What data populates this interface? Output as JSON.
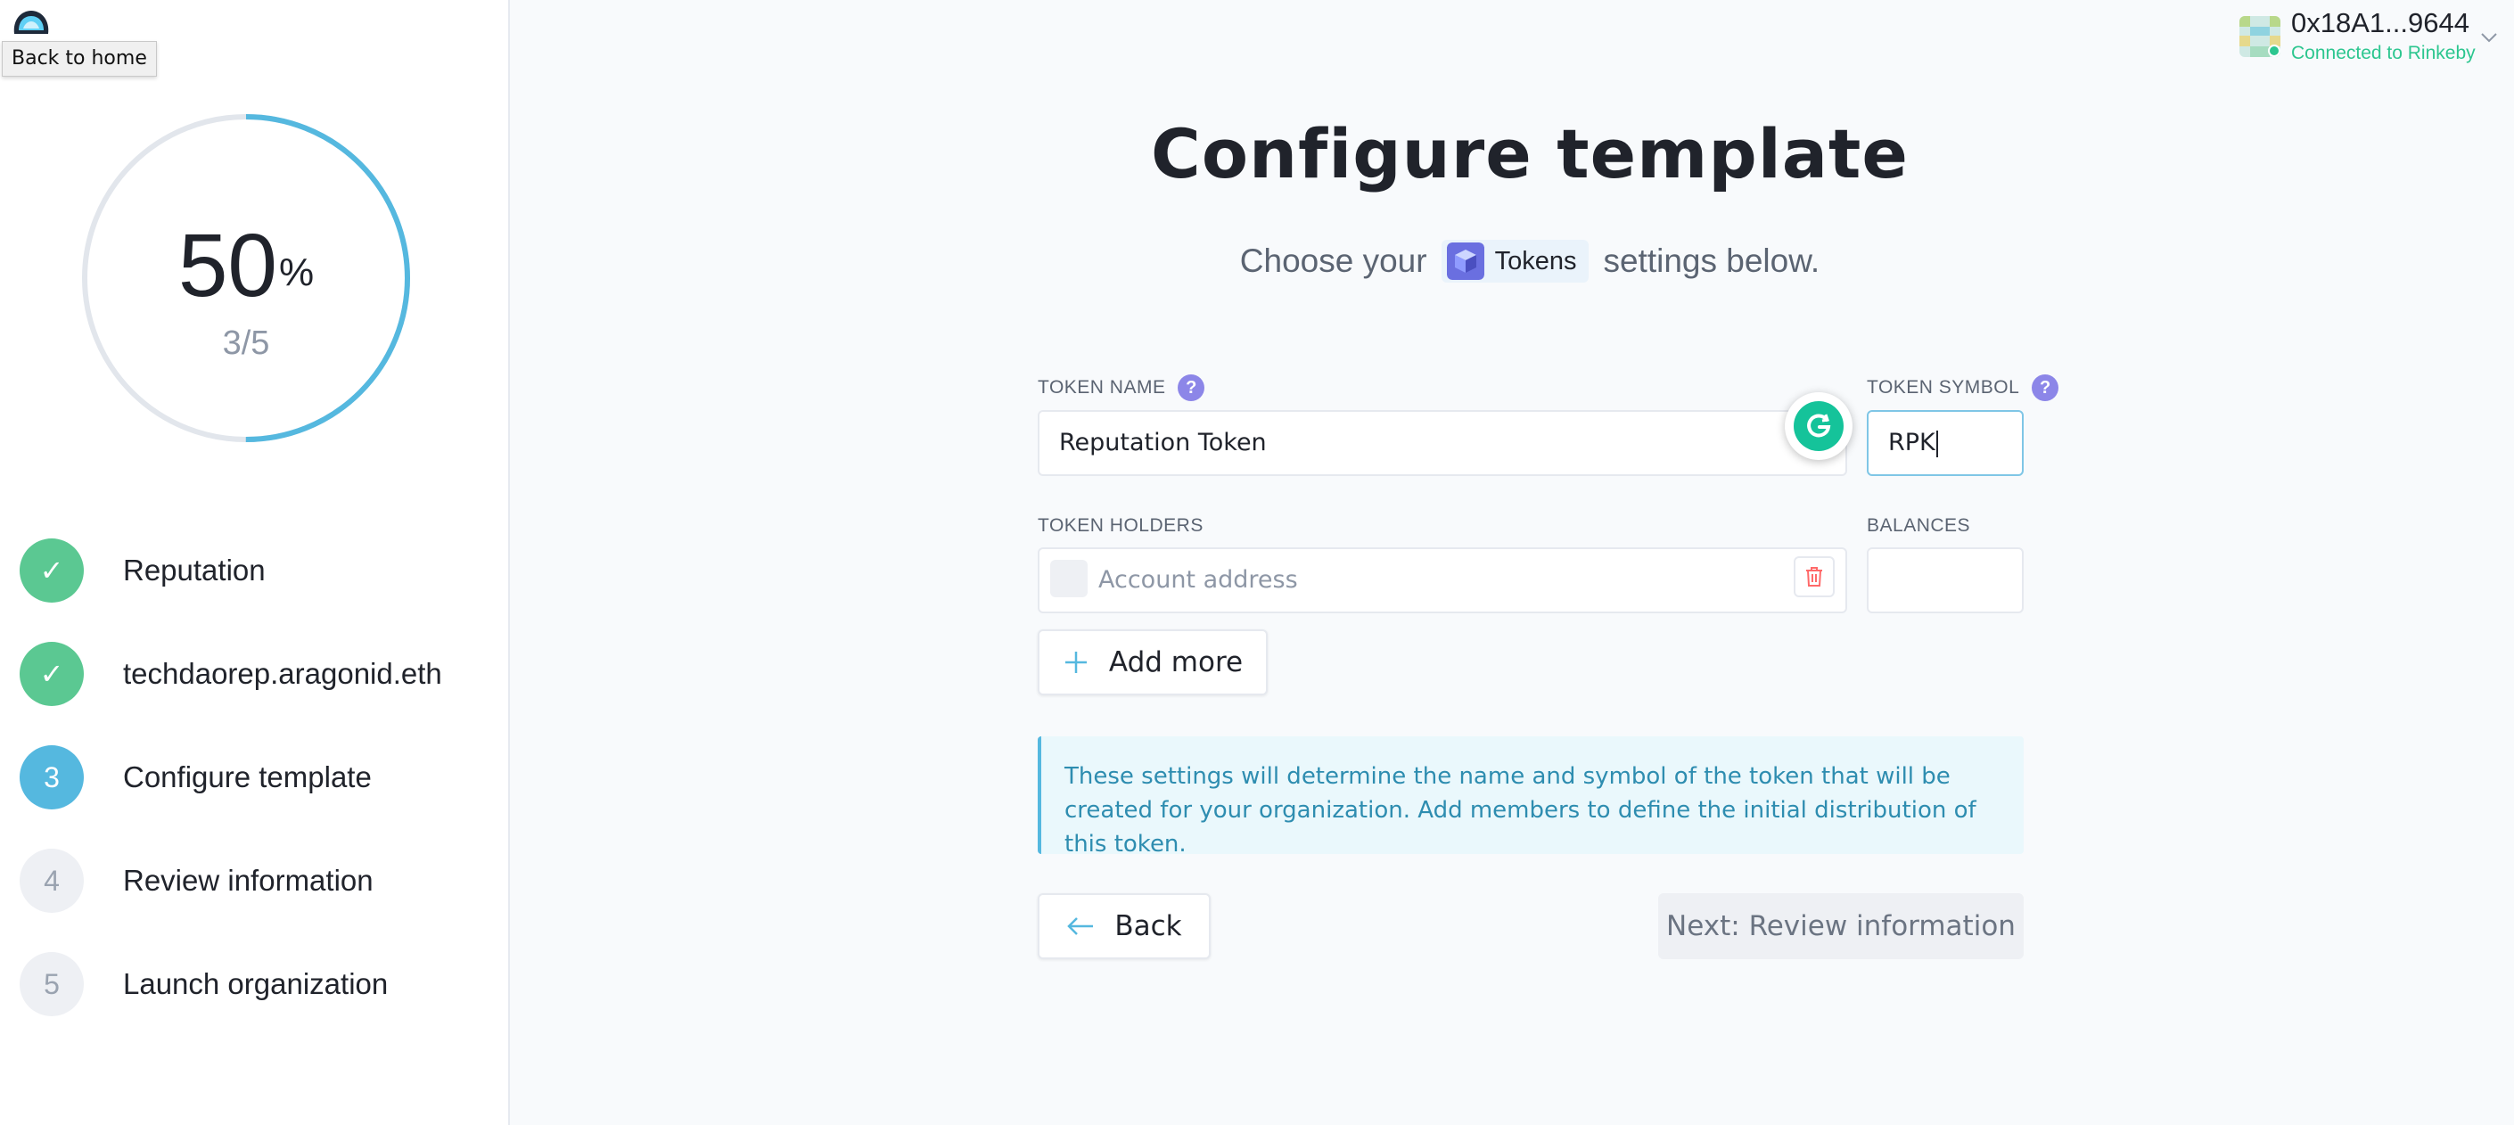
{
  "home": {
    "tooltip": "Back to home",
    "logo_icon": "aragon-logo-icon"
  },
  "progress": {
    "percent": "50",
    "percent_sign": "%",
    "fraction": "3/5",
    "value": 0.5,
    "color_track": "#e2e6ec",
    "color_fill": "#55b8df"
  },
  "steps": [
    {
      "number": "✓",
      "label": "Reputation",
      "state": "done"
    },
    {
      "number": "✓",
      "label": "techdaorep.aragonid.eth",
      "state": "done"
    },
    {
      "number": "3",
      "label": "Configure template",
      "state": "active"
    },
    {
      "number": "4",
      "label": "Review information",
      "state": "todo"
    },
    {
      "number": "5",
      "label": "Launch organization",
      "state": "todo"
    }
  ],
  "account": {
    "address": "0x18A1...9644",
    "network": "Connected to Rinkeby",
    "status_color": "#2cc68f"
  },
  "main": {
    "title": "Configure template",
    "subtitle_prefix": "Choose your",
    "template_name": "Tokens",
    "subtitle_suffix": "settings below."
  },
  "form": {
    "token_name_label": "TOKEN NAME",
    "token_name_value": "Reputation Token",
    "token_symbol_label": "TOKEN SYMBOL",
    "token_symbol_value": "RPK",
    "holders_label": "TOKEN HOLDERS",
    "balances_label": "BALANCES",
    "holder_placeholder": "Account address",
    "help_mark": "?",
    "add_more": "Add more"
  },
  "info": {
    "text": "These settings will determine the name and symbol of the token that will be created for your organization. Add members to define the initial distribution of this token."
  },
  "nav": {
    "back": "Back",
    "next": "Next: Review information"
  },
  "colors": {
    "accent": "#55b8df",
    "success": "#5bc892",
    "help": "#8c86e8",
    "danger": "#ff6969"
  }
}
